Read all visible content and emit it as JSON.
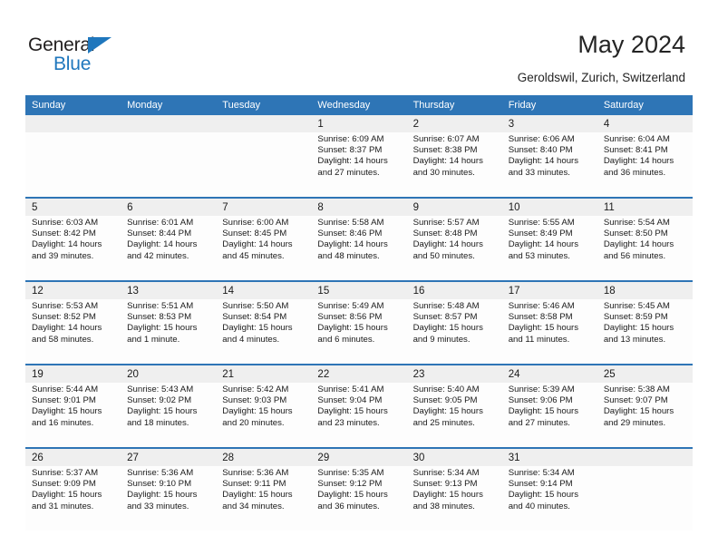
{
  "logo": {
    "word_top": "General",
    "word_bottom": "Blue",
    "triangle_color": "#1f77bd",
    "top_color": "#221f1f"
  },
  "header": {
    "title": "May 2024",
    "subtitle": "Geroldswil, Zurich, Switzerland"
  },
  "theme": {
    "header_blue": "#2e75b6",
    "daynum_band": "#efefef",
    "cell_bg": "#fdfdfd",
    "text": "#1a1a1a"
  },
  "calendar": {
    "weekday_headers": [
      "Sunday",
      "Monday",
      "Tuesday",
      "Wednesday",
      "Thursday",
      "Friday",
      "Saturday"
    ],
    "weeks": [
      [
        {
          "day": "",
          "sunrise": "",
          "sunset": "",
          "daylight_1": "",
          "daylight_2": ""
        },
        {
          "day": "",
          "sunrise": "",
          "sunset": "",
          "daylight_1": "",
          "daylight_2": ""
        },
        {
          "day": "",
          "sunrise": "",
          "sunset": "",
          "daylight_1": "",
          "daylight_2": ""
        },
        {
          "day": "1",
          "sunrise": "Sunrise: 6:09 AM",
          "sunset": "Sunset: 8:37 PM",
          "daylight_1": "Daylight: 14 hours",
          "daylight_2": "and 27 minutes."
        },
        {
          "day": "2",
          "sunrise": "Sunrise: 6:07 AM",
          "sunset": "Sunset: 8:38 PM",
          "daylight_1": "Daylight: 14 hours",
          "daylight_2": "and 30 minutes."
        },
        {
          "day": "3",
          "sunrise": "Sunrise: 6:06 AM",
          "sunset": "Sunset: 8:40 PM",
          "daylight_1": "Daylight: 14 hours",
          "daylight_2": "and 33 minutes."
        },
        {
          "day": "4",
          "sunrise": "Sunrise: 6:04 AM",
          "sunset": "Sunset: 8:41 PM",
          "daylight_1": "Daylight: 14 hours",
          "daylight_2": "and 36 minutes."
        }
      ],
      [
        {
          "day": "5",
          "sunrise": "Sunrise: 6:03 AM",
          "sunset": "Sunset: 8:42 PM",
          "daylight_1": "Daylight: 14 hours",
          "daylight_2": "and 39 minutes."
        },
        {
          "day": "6",
          "sunrise": "Sunrise: 6:01 AM",
          "sunset": "Sunset: 8:44 PM",
          "daylight_1": "Daylight: 14 hours",
          "daylight_2": "and 42 minutes."
        },
        {
          "day": "7",
          "sunrise": "Sunrise: 6:00 AM",
          "sunset": "Sunset: 8:45 PM",
          "daylight_1": "Daylight: 14 hours",
          "daylight_2": "and 45 minutes."
        },
        {
          "day": "8",
          "sunrise": "Sunrise: 5:58 AM",
          "sunset": "Sunset: 8:46 PM",
          "daylight_1": "Daylight: 14 hours",
          "daylight_2": "and 48 minutes."
        },
        {
          "day": "9",
          "sunrise": "Sunrise: 5:57 AM",
          "sunset": "Sunset: 8:48 PM",
          "daylight_1": "Daylight: 14 hours",
          "daylight_2": "and 50 minutes."
        },
        {
          "day": "10",
          "sunrise": "Sunrise: 5:55 AM",
          "sunset": "Sunset: 8:49 PM",
          "daylight_1": "Daylight: 14 hours",
          "daylight_2": "and 53 minutes."
        },
        {
          "day": "11",
          "sunrise": "Sunrise: 5:54 AM",
          "sunset": "Sunset: 8:50 PM",
          "daylight_1": "Daylight: 14 hours",
          "daylight_2": "and 56 minutes."
        }
      ],
      [
        {
          "day": "12",
          "sunrise": "Sunrise: 5:53 AM",
          "sunset": "Sunset: 8:52 PM",
          "daylight_1": "Daylight: 14 hours",
          "daylight_2": "and 58 minutes."
        },
        {
          "day": "13",
          "sunrise": "Sunrise: 5:51 AM",
          "sunset": "Sunset: 8:53 PM",
          "daylight_1": "Daylight: 15 hours",
          "daylight_2": "and 1 minute."
        },
        {
          "day": "14",
          "sunrise": "Sunrise: 5:50 AM",
          "sunset": "Sunset: 8:54 PM",
          "daylight_1": "Daylight: 15 hours",
          "daylight_2": "and 4 minutes."
        },
        {
          "day": "15",
          "sunrise": "Sunrise: 5:49 AM",
          "sunset": "Sunset: 8:56 PM",
          "daylight_1": "Daylight: 15 hours",
          "daylight_2": "and 6 minutes."
        },
        {
          "day": "16",
          "sunrise": "Sunrise: 5:48 AM",
          "sunset": "Sunset: 8:57 PM",
          "daylight_1": "Daylight: 15 hours",
          "daylight_2": "and 9 minutes."
        },
        {
          "day": "17",
          "sunrise": "Sunrise: 5:46 AM",
          "sunset": "Sunset: 8:58 PM",
          "daylight_1": "Daylight: 15 hours",
          "daylight_2": "and 11 minutes."
        },
        {
          "day": "18",
          "sunrise": "Sunrise: 5:45 AM",
          "sunset": "Sunset: 8:59 PM",
          "daylight_1": "Daylight: 15 hours",
          "daylight_2": "and 13 minutes."
        }
      ],
      [
        {
          "day": "19",
          "sunrise": "Sunrise: 5:44 AM",
          "sunset": "Sunset: 9:01 PM",
          "daylight_1": "Daylight: 15 hours",
          "daylight_2": "and 16 minutes."
        },
        {
          "day": "20",
          "sunrise": "Sunrise: 5:43 AM",
          "sunset": "Sunset: 9:02 PM",
          "daylight_1": "Daylight: 15 hours",
          "daylight_2": "and 18 minutes."
        },
        {
          "day": "21",
          "sunrise": "Sunrise: 5:42 AM",
          "sunset": "Sunset: 9:03 PM",
          "daylight_1": "Daylight: 15 hours",
          "daylight_2": "and 20 minutes."
        },
        {
          "day": "22",
          "sunrise": "Sunrise: 5:41 AM",
          "sunset": "Sunset: 9:04 PM",
          "daylight_1": "Daylight: 15 hours",
          "daylight_2": "and 23 minutes."
        },
        {
          "day": "23",
          "sunrise": "Sunrise: 5:40 AM",
          "sunset": "Sunset: 9:05 PM",
          "daylight_1": "Daylight: 15 hours",
          "daylight_2": "and 25 minutes."
        },
        {
          "day": "24",
          "sunrise": "Sunrise: 5:39 AM",
          "sunset": "Sunset: 9:06 PM",
          "daylight_1": "Daylight: 15 hours",
          "daylight_2": "and 27 minutes."
        },
        {
          "day": "25",
          "sunrise": "Sunrise: 5:38 AM",
          "sunset": "Sunset: 9:07 PM",
          "daylight_1": "Daylight: 15 hours",
          "daylight_2": "and 29 minutes."
        }
      ],
      [
        {
          "day": "26",
          "sunrise": "Sunrise: 5:37 AM",
          "sunset": "Sunset: 9:09 PM",
          "daylight_1": "Daylight: 15 hours",
          "daylight_2": "and 31 minutes."
        },
        {
          "day": "27",
          "sunrise": "Sunrise: 5:36 AM",
          "sunset": "Sunset: 9:10 PM",
          "daylight_1": "Daylight: 15 hours",
          "daylight_2": "and 33 minutes."
        },
        {
          "day": "28",
          "sunrise": "Sunrise: 5:36 AM",
          "sunset": "Sunset: 9:11 PM",
          "daylight_1": "Daylight: 15 hours",
          "daylight_2": "and 34 minutes."
        },
        {
          "day": "29",
          "sunrise": "Sunrise: 5:35 AM",
          "sunset": "Sunset: 9:12 PM",
          "daylight_1": "Daylight: 15 hours",
          "daylight_2": "and 36 minutes."
        },
        {
          "day": "30",
          "sunrise": "Sunrise: 5:34 AM",
          "sunset": "Sunset: 9:13 PM",
          "daylight_1": "Daylight: 15 hours",
          "daylight_2": "and 38 minutes."
        },
        {
          "day": "31",
          "sunrise": "Sunrise: 5:34 AM",
          "sunset": "Sunset: 9:14 PM",
          "daylight_1": "Daylight: 15 hours",
          "daylight_2": "and 40 minutes."
        },
        {
          "day": "",
          "sunrise": "",
          "sunset": "",
          "daylight_1": "",
          "daylight_2": ""
        }
      ]
    ]
  }
}
